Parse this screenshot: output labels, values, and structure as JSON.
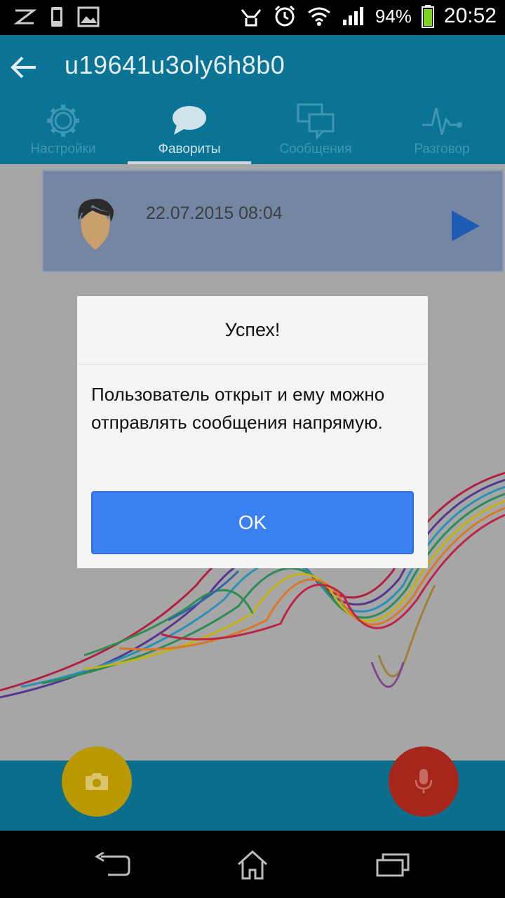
{
  "status_bar": {
    "battery_percent": "94%",
    "time": "20:52",
    "icons": [
      "z-logo-icon",
      "phone-icon",
      "image-icon",
      "hand-icon",
      "alarm-icon",
      "wifi-icon",
      "signal-icon",
      "battery-icon"
    ]
  },
  "app_bar": {
    "title": "u19641u3oly6h8b0",
    "tabs": [
      {
        "label": "Настройки",
        "icon": "gear-icon",
        "active": false
      },
      {
        "label": "Фавориты",
        "icon": "chat-bubble-icon",
        "active": true
      },
      {
        "label": "Сообщения",
        "icon": "messages-icon",
        "active": false
      },
      {
        "label": "Разговор",
        "icon": "pulse-icon",
        "active": false
      }
    ]
  },
  "favorites": {
    "items": [
      {
        "date": "22.07.2015 08:04",
        "avatar": "user-avatar",
        "action_icon": "play-icon"
      }
    ]
  },
  "dialog": {
    "title": "Успех!",
    "message": "Пользователь открыт и ему можно отправлять сообщения напрямую.",
    "ok_label": "OK"
  },
  "bottom_bar": {
    "camera_icon": "camera-icon",
    "mic_icon": "microphone-icon",
    "colors": {
      "camera": "#b99800",
      "mic": "#a6261c"
    }
  },
  "nav_bar": {
    "icons": [
      "back-icon",
      "home-icon",
      "recents-icon"
    ]
  },
  "colors": {
    "primary": "#0b7494",
    "accent_button": "#3a80f0",
    "card": "#7486a2"
  }
}
